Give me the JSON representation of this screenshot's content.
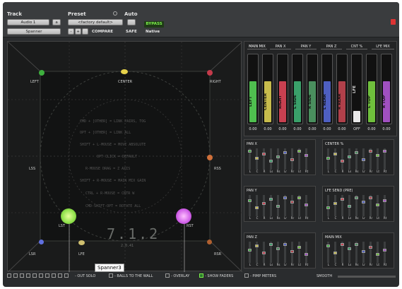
{
  "header": {
    "track_label": "Track",
    "preset_label": "Preset",
    "auto_label": "Auto",
    "track_value": "Audio 1",
    "track_suffix": "a",
    "plugin_value": "Spanner",
    "preset_value": "<factory default>",
    "compare_label": "COMPARE",
    "safe_label": "SAFE",
    "bypass_label": "BYPASS",
    "native_label": "Native",
    "plus": "+",
    "minus": "-"
  },
  "panner": {
    "speakers": [
      {
        "label": "LEFT",
        "color": "#3eb03e"
      },
      {
        "label": "CENTER",
        "color": "#e6d24a"
      },
      {
        "label": "RIGHT",
        "color": "#c43a4a"
      },
      {
        "label": "LSS",
        "color": "#2a8fd0"
      },
      {
        "label": "RSS",
        "color": "#d0703a"
      },
      {
        "label": "LST",
        "color": "#8ee04a"
      },
      {
        "label": "RST",
        "color": "#d060e8"
      },
      {
        "label": "LSR",
        "color": "#6070e0"
      },
      {
        "label": "LFE",
        "color": "#d0c070"
      },
      {
        "label": "RSR",
        "color": "#b06030"
      }
    ],
    "help_lines": [
      "CMD + [OTHER] = LINK PAIRS, TOG",
      "OPT + [OTHER] = LINK ALL",
      "SHIFT + L-MOUSE = MOVE ABSOLUTE",
      "OPT CLICK = DEFAULT",
      "R-MOUSE DRAG = Z AXIS",
      "SHIFT + R-MOUSE = MAIN MIX GAIN",
      "CTRL + R-MOUSE = CNTR W",
      "CMD-SHIFT-OPT = ROTATE ALL"
    ],
    "format": "7.1.2",
    "version": "2.0.41"
  },
  "tabs": [
    "MAIN MIX",
    "PAN X",
    "PAN Y",
    "PAN Z",
    "CNT %",
    "LFE MIX"
  ],
  "faders": [
    {
      "label": "LEFT",
      "color": "#4fbf4f",
      "level": 0.6,
      "value": "0.00"
    },
    {
      "label": "CENTER",
      "color": "#c7bb4c",
      "level": 0.6,
      "value": "0.00"
    },
    {
      "label": "RIGHT",
      "color": "#c84050",
      "level": 0.6,
      "value": "0.00"
    },
    {
      "label": "L SIDE",
      "color": "#3aa06a",
      "level": 0.6,
      "value": "0.00"
    },
    {
      "label": "R SIDE",
      "color": "#4a8f5e",
      "level": 0.6,
      "value": "0.00"
    },
    {
      "label": "L REAR",
      "color": "#4e5fc0",
      "level": 0.6,
      "value": "0.00"
    },
    {
      "label": "R REAR",
      "color": "#b0404a",
      "level": 0.6,
      "value": "0.00"
    },
    {
      "label": "LFE",
      "color": "#d8d8d8",
      "level": 0.0,
      "value": "OFF"
    },
    {
      "label": "L TOP",
      "color": "#6fbf3c",
      "level": 0.6,
      "value": "0.00"
    },
    {
      "label": "R TOP",
      "color": "#a050c0",
      "level": 0.6,
      "value": "0.00"
    }
  ],
  "sections": [
    {
      "title": "PAN X"
    },
    {
      "title": "CENTER %"
    },
    {
      "title": "PAN Y"
    },
    {
      "title": "LFE SEND (PRE)"
    },
    {
      "title": "PAN Z"
    },
    {
      "title": "MAIN MIX"
    }
  ],
  "slider_labels": [
    "L",
    "C",
    "R",
    "Ls",
    "Rs",
    "Lr",
    "Rr",
    "Lt",
    "Rt"
  ],
  "footer": {
    "out_solo": "- OUT SOLO",
    "balls": "- BALLS TO THE WALL",
    "overlay": "- OVERLAY",
    "show_faders": "- SHOW FADERS",
    "pimp": "- PIMP METERS",
    "smooth": "SMOOTH"
  },
  "tooltip": "Spanner3"
}
